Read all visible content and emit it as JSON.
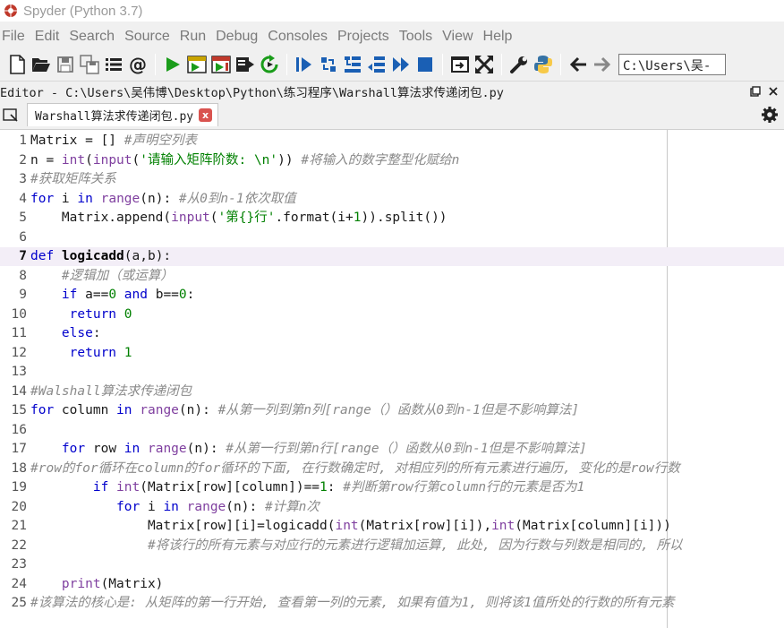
{
  "window": {
    "title": "Spyder (Python 3.7)"
  },
  "menu": [
    "File",
    "Edit",
    "Search",
    "Source",
    "Run",
    "Debug",
    "Consoles",
    "Projects",
    "Tools",
    "View",
    "Help"
  ],
  "toolbar": {
    "icons": [
      "new-file-icon",
      "open-file-icon",
      "save-icon",
      "save-all-icon",
      "outline-icon",
      "at-icon",
      "run-icon",
      "run-cell-icon",
      "run-cell-advance-icon",
      "run-selection-icon",
      "rerun-icon",
      "debug-icon",
      "step-icon",
      "step-into-icon",
      "step-return-icon",
      "continue-icon",
      "stop-icon",
      "maximize-pane-icon",
      "fullscreen-icon",
      "wrench-icon",
      "python-icon",
      "back-arrow-icon",
      "forward-arrow-icon"
    ],
    "path_value": "C:\\Users\\吴-"
  },
  "editor_pane": {
    "title": "Editor - C:\\Users\\吴伟博\\Desktop\\Python\\练习程序\\Warshall算法求传递闭包.py",
    "tab_label": "Warshall算法求传递闭包.py",
    "tab_close": "x"
  },
  "code": {
    "current_line": 7,
    "lines": [
      {
        "n": "1",
        "t": "Matrix = [] #声明空列表"
      },
      {
        "n": "2",
        "t": "n = int(input('请输入矩阵阶数: \\n')) #将输入的数字整型化赋给n"
      },
      {
        "n": "3",
        "t": "#获取矩阵关系"
      },
      {
        "n": "4",
        "t": "for i in range(n): #从0到n-1依次取值"
      },
      {
        "n": "5",
        "t": "    Matrix.append(input('第{}行'.format(i+1)).split())"
      },
      {
        "n": "6",
        "t": ""
      },
      {
        "n": "7",
        "t": "def logicadd(a,b):"
      },
      {
        "n": "8",
        "t": "    #逻辑加（或运算）"
      },
      {
        "n": "9",
        "t": "    if a==0 and b==0:"
      },
      {
        "n": "10",
        "t": "     return 0"
      },
      {
        "n": "11",
        "t": "    else:"
      },
      {
        "n": "12",
        "t": "     return 1"
      },
      {
        "n": "13",
        "t": ""
      },
      {
        "n": "14",
        "t": "#Walshall算法求传递闭包"
      },
      {
        "n": "15",
        "t": "for column in range(n): #从第一列到第n列[range（）函数从0到n-1但是不影响算法]"
      },
      {
        "n": "16",
        "t": ""
      },
      {
        "n": "17",
        "t": "    for row in range(n): #从第一行到第n行[range（）函数从0到n-1但是不影响算法]"
      },
      {
        "n": "18",
        "t": "#row的for循环在column的for循环的下面, 在行数确定时, 对相应列的所有元素进行遍历, 变化的是row行数"
      },
      {
        "n": "19",
        "t": "        if int(Matrix[row][column])==1: #判断第row行第column行的元素是否为1"
      },
      {
        "n": "20",
        "t": "           for i in range(n): #计算n次"
      },
      {
        "n": "21",
        "t": "               Matrix[row][i]=logicadd(int(Matrix[row][i]),int(Matrix[column][i]))"
      },
      {
        "n": "22",
        "t": "               #将该行的所有元素与对应行的元素进行逻辑加运算, 此处, 因为行数与列数是相同的, 所以"
      },
      {
        "n": "23",
        "t": ""
      },
      {
        "n": "24",
        "t": "    print(Matrix)"
      },
      {
        "n": "25",
        "t": "#该算法的核心是: 从矩阵的第一行开始, 查看第一列的元素, 如果有值为1, 则将该1值所处的行数的所有元素"
      }
    ]
  }
}
